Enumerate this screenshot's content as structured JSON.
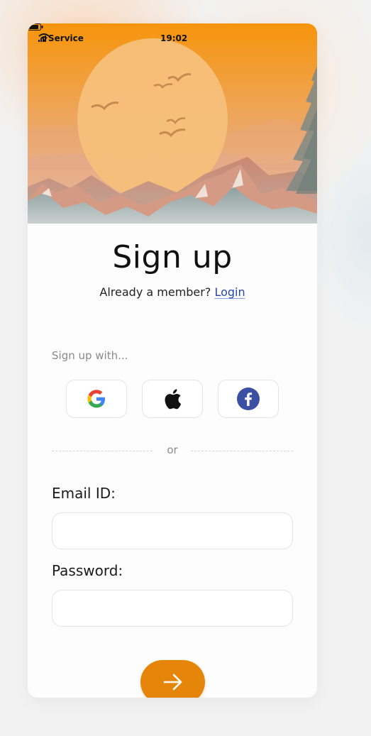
{
  "status_bar": {
    "carrier": "Service",
    "time": "19:02"
  },
  "signup": {
    "title": "Sign up",
    "member_prompt": "Already a member?",
    "login_label": "Login",
    "signup_with": "Sign up with...",
    "or": "or",
    "email_label": "Email ID:",
    "email_value": "",
    "password_label": "Password:",
    "password_value": ""
  },
  "social": [
    "google-icon",
    "apple-icon",
    "facebook-icon"
  ],
  "submit_icon": "arrow-right-icon",
  "colors": {
    "accent": "#e5860b",
    "link": "#2446a8",
    "facebook": "#3b4fa3",
    "hero_top": "#f6960d",
    "hero_bottom": "#e2a983"
  }
}
